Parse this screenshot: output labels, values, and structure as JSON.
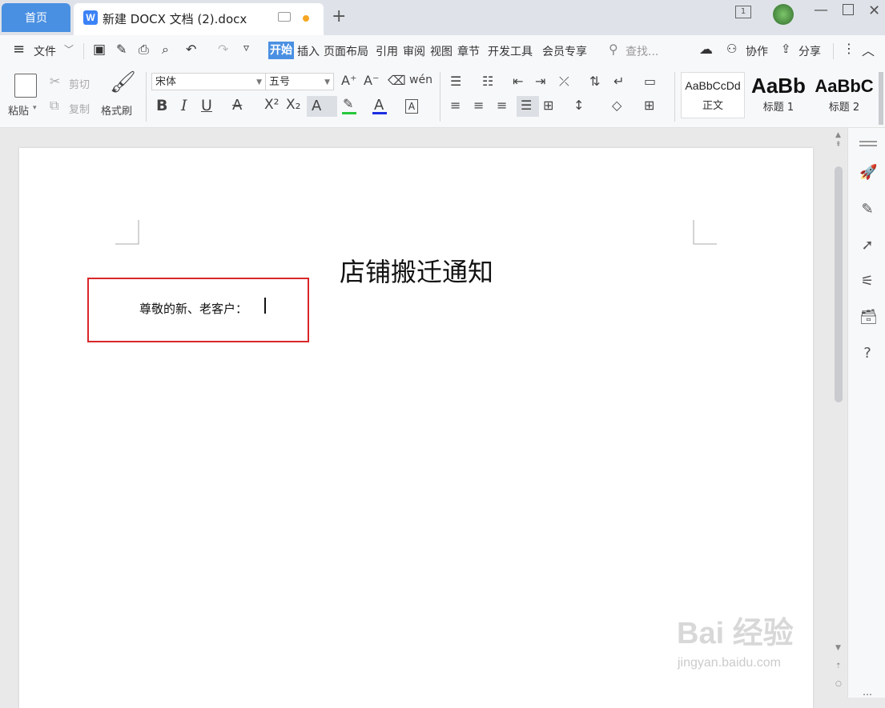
{
  "titlebar": {
    "home_tab": "首页",
    "doc_tab": "新建 DOCX 文档 (2).docx",
    "doc_tab_icon_letter": "W",
    "new_tab": "+"
  },
  "menu": {
    "file": "文件",
    "tabs": [
      "开始",
      "插入",
      "页面布局",
      "引用",
      "审阅",
      "视图",
      "章节",
      "开发工具",
      "会员专享"
    ],
    "search_placeholder": "查找...",
    "collab": "协作",
    "share": "分享"
  },
  "ribbon": {
    "paste": "粘贴",
    "cut": "剪切",
    "copy": "复制",
    "format_painter": "格式刷",
    "font_name": "宋体",
    "font_size": "五号",
    "styles": [
      {
        "preview": "AaBbCcDd",
        "name": "正文"
      },
      {
        "preview": "AaBb",
        "name": "标题 1"
      },
      {
        "preview": "AaBbC",
        "name": "标题 2"
      }
    ]
  },
  "document": {
    "title": "店铺搬迁通知",
    "greeting": "尊敬的新、老客户："
  },
  "watermark": {
    "text": "Bai 经验",
    "url": "jingyan.baidu.com"
  },
  "colors": {
    "accent": "#4a90e2",
    "highlight_box": "#d9262a",
    "unsaved_dot": "#f5a623"
  }
}
